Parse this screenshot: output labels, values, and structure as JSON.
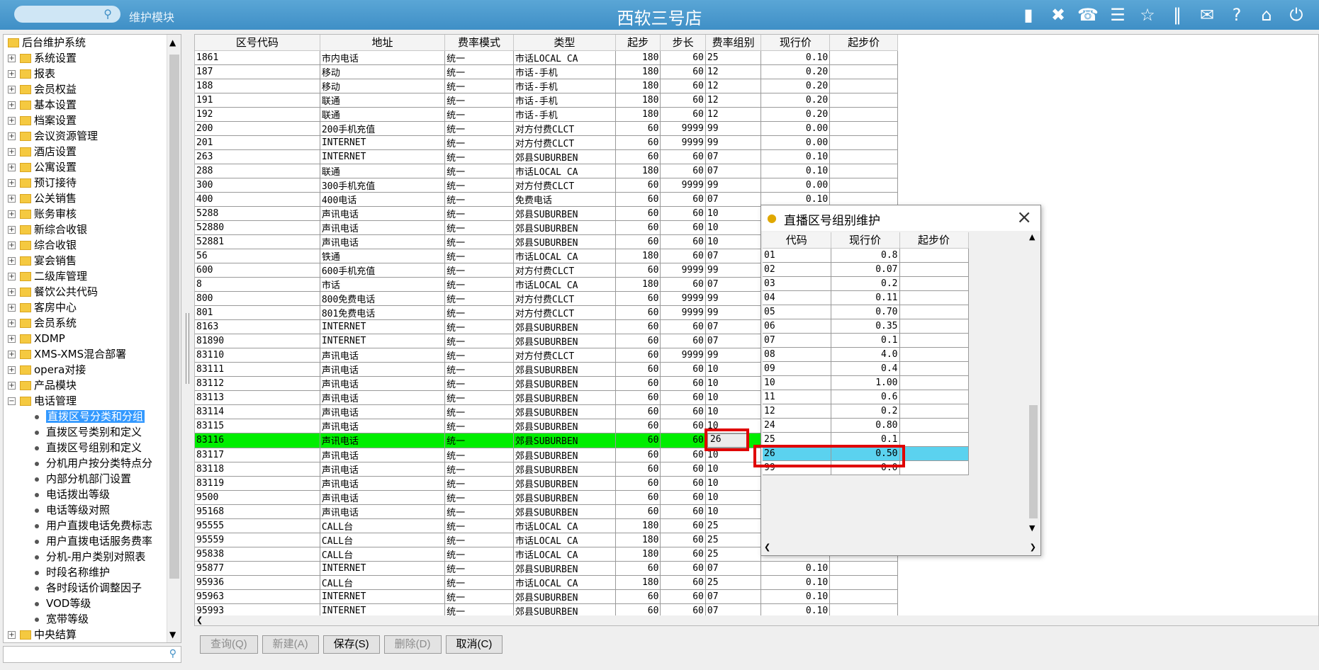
{
  "header": {
    "search_placeholder": "",
    "module_label": "维护模块",
    "app_title": "西软三号店",
    "icons": [
      "signal-icon",
      "tools-icon",
      "phone-icon",
      "menu-icon",
      "star-icon",
      "columns-icon",
      "mail-icon",
      "help-icon",
      "home-icon",
      "power-icon"
    ]
  },
  "sidebar": {
    "items": [
      {
        "label": "后台维护系统",
        "level": 0,
        "expanded": true
      },
      {
        "label": "系统设置",
        "level": 1
      },
      {
        "label": "报表",
        "level": 1
      },
      {
        "label": "会员权益",
        "level": 1
      },
      {
        "label": "基本设置",
        "level": 1
      },
      {
        "label": "档案设置",
        "level": 1
      },
      {
        "label": "会议资源管理",
        "level": 1
      },
      {
        "label": "酒店设置",
        "level": 1
      },
      {
        "label": "公寓设置",
        "level": 1
      },
      {
        "label": "预订接待",
        "level": 1
      },
      {
        "label": "公关销售",
        "level": 1
      },
      {
        "label": "账务审核",
        "level": 1
      },
      {
        "label": "新综合收银",
        "level": 1
      },
      {
        "label": "综合收银",
        "level": 1
      },
      {
        "label": "宴会销售",
        "level": 1
      },
      {
        "label": "二级库管理",
        "level": 1
      },
      {
        "label": "餐饮公共代码",
        "level": 1
      },
      {
        "label": "客房中心",
        "level": 1
      },
      {
        "label": "会员系统",
        "level": 1
      },
      {
        "label": "XDMP",
        "level": 1
      },
      {
        "label": "XMS-XMS混合部署",
        "level": 1
      },
      {
        "label": "opera对接",
        "level": 1
      },
      {
        "label": "产品模块",
        "level": 1
      },
      {
        "label": "电话管理",
        "level": 1,
        "expanded": true
      },
      {
        "label": "直拨区号分类和分组",
        "level": 2,
        "selected": true
      },
      {
        "label": "直拨区号类别和定义",
        "level": 2
      },
      {
        "label": "直拨区号组别和定义",
        "level": 2
      },
      {
        "label": "分机用户按分类特点分",
        "level": 2
      },
      {
        "label": "内部分机部门设置",
        "level": 2
      },
      {
        "label": "电话拨出等级",
        "level": 2
      },
      {
        "label": "电话等级对照",
        "level": 2
      },
      {
        "label": "用户直拨电话免费标志",
        "level": 2
      },
      {
        "label": "用户直拨电话服务费率",
        "level": 2
      },
      {
        "label": "分机-用户类别对照表",
        "level": 2
      },
      {
        "label": "时段名称维护",
        "level": 2
      },
      {
        "label": "各时段话价调整因子",
        "level": 2
      },
      {
        "label": "VOD等级",
        "level": 2
      },
      {
        "label": "宽带等级",
        "level": 2
      },
      {
        "label": "中央结算",
        "level": 1
      }
    ]
  },
  "grid": {
    "columns": [
      "区号代码",
      "地址",
      "费率模式",
      "类型",
      "起步",
      "步长",
      "费率组别",
      "现行价",
      "起步价"
    ],
    "rows": [
      [
        "1861",
        "市内电话",
        "统一",
        "市话LOCAL CA",
        "180",
        "60",
        "25",
        "0.10",
        ""
      ],
      [
        "187",
        "移动",
        "统一",
        "市话-手机",
        "180",
        "60",
        "12",
        "0.20",
        ""
      ],
      [
        "188",
        "移动",
        "统一",
        "市话-手机",
        "180",
        "60",
        "12",
        "0.20",
        ""
      ],
      [
        "191",
        "联通",
        "统一",
        "市话-手机",
        "180",
        "60",
        "12",
        "0.20",
        ""
      ],
      [
        "192",
        "联通",
        "统一",
        "市话-手机",
        "180",
        "60",
        "12",
        "0.20",
        ""
      ],
      [
        "200",
        "200手机充值",
        "统一",
        "对方付费CLCT",
        "60",
        "9999",
        "99",
        "0.00",
        ""
      ],
      [
        "201",
        "INTERNET",
        "统一",
        "对方付费CLCT",
        "60",
        "9999",
        "99",
        "0.00",
        ""
      ],
      [
        "263",
        "INTERNET",
        "统一",
        "郊县SUBURBEN",
        "60",
        "60",
        "07",
        "0.10",
        ""
      ],
      [
        "288",
        "联通",
        "统一",
        "市话LOCAL CA",
        "180",
        "60",
        "07",
        "0.10",
        ""
      ],
      [
        "300",
        "300手机充值",
        "统一",
        "对方付费CLCT",
        "60",
        "9999",
        "99",
        "0.00",
        ""
      ],
      [
        "400",
        "400电话",
        "统一",
        "免费电话",
        "60",
        "60",
        "07",
        "0.10",
        ""
      ],
      [
        "5288",
        "声讯电话",
        "统一",
        "郊县SUBURBEN",
        "60",
        "60",
        "10",
        "",
        ""
      ],
      [
        "52880",
        "声讯电话",
        "统一",
        "郊县SUBURBEN",
        "60",
        "60",
        "10",
        "",
        ""
      ],
      [
        "52881",
        "声讯电话",
        "统一",
        "郊县SUBURBEN",
        "60",
        "60",
        "10",
        "",
        ""
      ],
      [
        "56",
        "铁通",
        "统一",
        "市话LOCAL CA",
        "180",
        "60",
        "07",
        "",
        ""
      ],
      [
        "600",
        "600手机充值",
        "统一",
        "对方付费CLCT",
        "60",
        "9999",
        "99",
        "",
        ""
      ],
      [
        "8",
        "市话",
        "统一",
        "市话LOCAL CA",
        "180",
        "60",
        "07",
        "",
        ""
      ],
      [
        "800",
        "800免费电话",
        "统一",
        "对方付费CLCT",
        "60",
        "9999",
        "99",
        "",
        ""
      ],
      [
        "801",
        "801免费电话",
        "统一",
        "对方付费CLCT",
        "60",
        "9999",
        "99",
        "",
        ""
      ],
      [
        "8163",
        "INTERNET",
        "统一",
        "郊县SUBURBEN",
        "60",
        "60",
        "07",
        "",
        ""
      ],
      [
        "81890",
        "INTERNET",
        "统一",
        "郊县SUBURBEN",
        "60",
        "60",
        "07",
        "",
        ""
      ],
      [
        "83110",
        "声讯电话",
        "统一",
        "对方付费CLCT",
        "60",
        "9999",
        "99",
        "",
        ""
      ],
      [
        "83111",
        "声讯电话",
        "统一",
        "郊县SUBURBEN",
        "60",
        "60",
        "10",
        "",
        ""
      ],
      [
        "83112",
        "声讯电话",
        "统一",
        "郊县SUBURBEN",
        "60",
        "60",
        "10",
        "",
        ""
      ],
      [
        "83113",
        "声讯电话",
        "统一",
        "郊县SUBURBEN",
        "60",
        "60",
        "10",
        "",
        ""
      ],
      [
        "83114",
        "声讯电话",
        "统一",
        "郊县SUBURBEN",
        "60",
        "60",
        "10",
        "",
        ""
      ],
      [
        "83115",
        "声讯电话",
        "统一",
        "郊县SUBURBEN",
        "60",
        "60",
        "10",
        "",
        ""
      ],
      [
        "83116",
        "声讯电话",
        "统一",
        "郊县SUBURBEN",
        "60",
        "60",
        "26",
        "",
        ""
      ],
      [
        "83117",
        "声讯电话",
        "统一",
        "郊县SUBURBEN",
        "60",
        "60",
        "10",
        "",
        ""
      ],
      [
        "83118",
        "声讯电话",
        "统一",
        "郊县SUBURBEN",
        "60",
        "60",
        "10",
        "",
        ""
      ],
      [
        "83119",
        "声讯电话",
        "统一",
        "郊县SUBURBEN",
        "60",
        "60",
        "10",
        "",
        ""
      ],
      [
        "9500",
        "声讯电话",
        "统一",
        "郊县SUBURBEN",
        "60",
        "60",
        "10",
        "",
        ""
      ],
      [
        "95168",
        "声讯电话",
        "统一",
        "郊县SUBURBEN",
        "60",
        "60",
        "10",
        "",
        ""
      ],
      [
        "95555",
        "CALL台",
        "统一",
        "市话LOCAL CA",
        "180",
        "60",
        "25",
        "",
        ""
      ],
      [
        "95559",
        "CALL台",
        "统一",
        "市话LOCAL CA",
        "180",
        "60",
        "25",
        "",
        ""
      ],
      [
        "95838",
        "CALL台",
        "统一",
        "市话LOCAL CA",
        "180",
        "60",
        "25",
        "",
        ""
      ],
      [
        "95877",
        "INTERNET",
        "统一",
        "郊县SUBURBEN",
        "60",
        "60",
        "07",
        "0.10",
        ""
      ],
      [
        "95936",
        "CALL台",
        "统一",
        "市话LOCAL CA",
        "180",
        "60",
        "25",
        "0.10",
        ""
      ],
      [
        "95963",
        "INTERNET",
        "统一",
        "郊县SUBURBEN",
        "60",
        "60",
        "07",
        "0.10",
        ""
      ],
      [
        "95993",
        "INTERNET",
        "统一",
        "郊县SUBURBEN",
        "60",
        "60",
        "07",
        "0.10",
        ""
      ]
    ],
    "highlighted_row": 27
  },
  "buttons": {
    "query": "查询(Q)",
    "new": "新建(A)",
    "save": "保存(S)",
    "delete": "删除(D)",
    "cancel": "取消(C)"
  },
  "popup": {
    "title": "直播区号组别维护",
    "columns": [
      "代码",
      "现行价",
      "起步价"
    ],
    "rows": [
      [
        "01",
        "0.8",
        ""
      ],
      [
        "02",
        "0.07",
        ""
      ],
      [
        "03",
        "0.2",
        ""
      ],
      [
        "04",
        "0.11",
        ""
      ],
      [
        "05",
        "0.70",
        ""
      ],
      [
        "06",
        "0.35",
        ""
      ],
      [
        "07",
        "0.1",
        ""
      ],
      [
        "08",
        "4.0",
        ""
      ],
      [
        "09",
        "0.4",
        ""
      ],
      [
        "10",
        "1.00",
        ""
      ],
      [
        "11",
        "0.6",
        ""
      ],
      [
        "12",
        "0.2",
        ""
      ],
      [
        "24",
        "0.80",
        ""
      ],
      [
        "25",
        "0.1",
        ""
      ],
      [
        "26",
        "0.50",
        ""
      ],
      [
        "99",
        "0.0",
        ""
      ]
    ],
    "highlighted_row": 14
  },
  "colors": {
    "header_bg": "#4a9ace",
    "highlight_row_main": "#00ee00",
    "highlight_row_popup": "#5bd2ef",
    "annotation_box": "#e00000",
    "tree_selected": "#3399ff"
  }
}
